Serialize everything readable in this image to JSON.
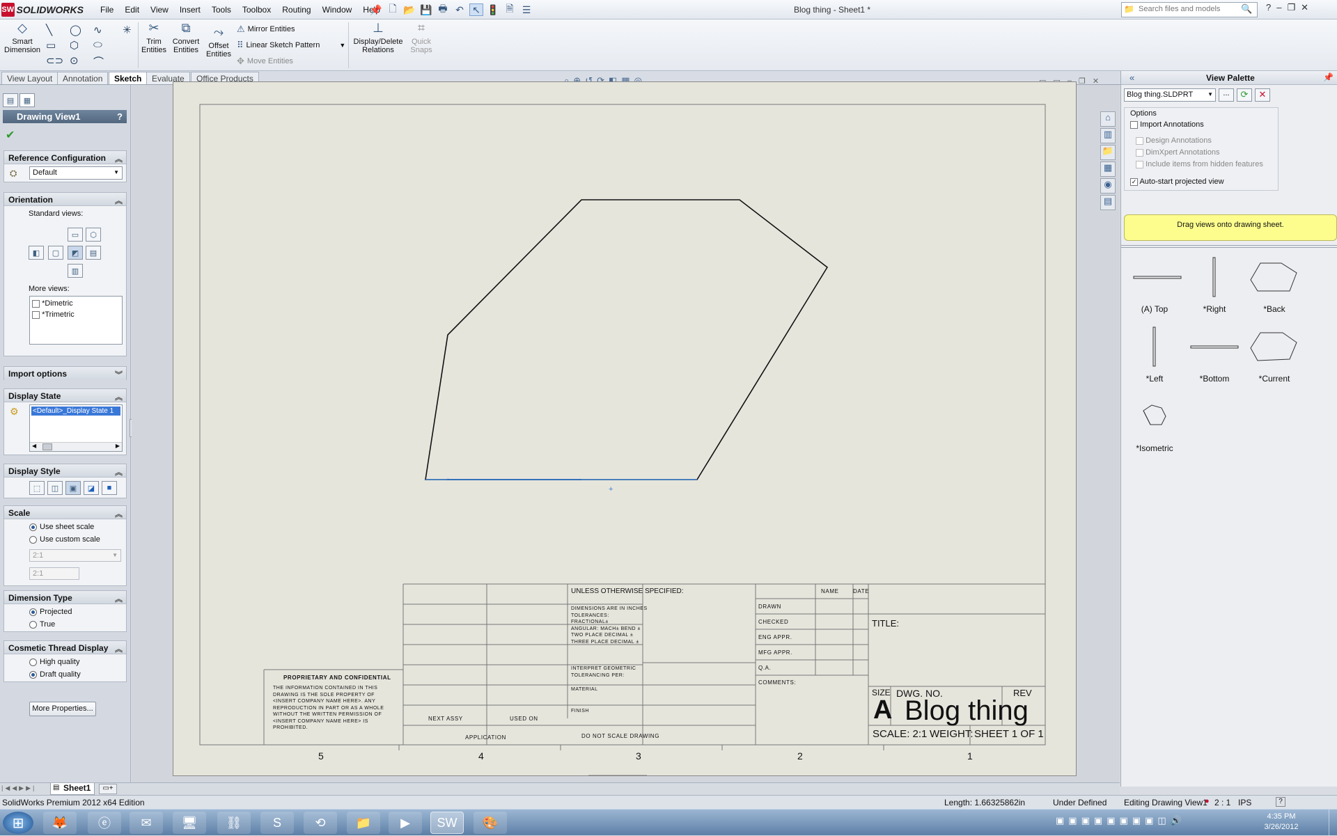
{
  "app": {
    "logo_text": "SOLIDWORKS",
    "document_title": "Blog thing - Sheet1 *",
    "menu": [
      "File",
      "Edit",
      "View",
      "Insert",
      "Tools",
      "Toolbox",
      "Routing",
      "Window",
      "Help"
    ],
    "search_placeholder": "Search files and models"
  },
  "ribbon": {
    "smart_dimension": "Smart Dimension",
    "trim_entities": "Trim Entities",
    "convert_entities": "Convert Entities",
    "offset_entities": "Offset Entities",
    "mirror_entities": "Mirror Entities",
    "linear_sketch_pattern": "Linear Sketch Pattern",
    "move_entities": "Move Entities",
    "display_delete_relations": "Display/Delete Relations",
    "quick_snaps": "Quick Snaps"
  },
  "tabs": [
    "View Layout",
    "Annotation",
    "Sketch",
    "Evaluate",
    "Office Products"
  ],
  "propertymanager": {
    "title": "Drawing View1",
    "help": "?",
    "ref_config": {
      "header": "Reference Configuration",
      "selected": "Default"
    },
    "orientation": {
      "header": "Orientation",
      "standard_views": "Standard views:",
      "more_views": "More views:",
      "more_list": [
        "*Dimetric",
        "*Trimetric"
      ]
    },
    "import_options": "Import options",
    "display_state": {
      "header": "Display State",
      "selected": "<Default>_Display State 1"
    },
    "display_style": "Display Style",
    "scale": {
      "header": "Scale",
      "use_sheet": "Use sheet scale",
      "use_custom": "Use custom scale",
      "select_value": "2:1",
      "custom_value": "2:1"
    },
    "dimension_type": {
      "header": "Dimension Type",
      "projected": "Projected",
      "true": "True"
    },
    "cosmetic_thread": {
      "header": "Cosmetic Thread Display",
      "high": "High quality",
      "draft": "Draft quality"
    },
    "more_properties": "More Properties..."
  },
  "palette": {
    "title": "View Palette",
    "file": "Blog thing.SLDPRT",
    "browse": "...",
    "options_label": "Options",
    "import_annotations": "Import Annotations",
    "design_annotations": "Design Annotations",
    "dimxpert_annotations": "DimXpert Annotations",
    "hidden_features": "Include items from hidden features",
    "auto_start": "Auto-start projected view",
    "hint": "Drag views onto drawing sheet.",
    "views": [
      "(A) Top",
      "*Right",
      "*Back",
      "*Left",
      "*Bottom",
      "*Current",
      "*Isometric"
    ]
  },
  "title_block": {
    "proprietary_header": "PROPRIETARY AND CONFIDENTIAL",
    "proprietary_text": [
      "THE INFORMATION CONTAINED IN THIS",
      "DRAWING IS THE SOLE PROPERTY OF",
      "<INSERT COMPANY NAME HERE>. ANY",
      "REPRODUCTION IN PART OR AS A WHOLE",
      "WITHOUT THE WRITTEN PERMISSION OF",
      "<INSERT COMPANY NAME HERE> IS",
      "PROHIBITED."
    ],
    "next_assy": "NEXT ASSY",
    "used_on": "USED ON",
    "application": "APPLICATION",
    "unless": "UNLESS OTHERWISE SPECIFIED:",
    "tolerance_lines": [
      "DIMENSIONS ARE IN INCHES",
      "TOLERANCES:",
      "FRACTIONAL±",
      "ANGULAR: MACH±    BEND ±",
      "TWO PLACE DECIMAL    ±",
      "THREE PLACE DECIMAL   ±"
    ],
    "interpret": [
      "INTERPRET GEOMETRIC",
      "TOLERANCING PER:"
    ],
    "material": "MATERIAL",
    "finish": "FINISH",
    "no_scale": "DO NOT SCALE DRAWING",
    "name_col": "NAME",
    "date_col": "DATE",
    "roles": [
      "DRAWN",
      "CHECKED",
      "ENG APPR.",
      "MFG APPR.",
      "Q.A."
    ],
    "comments": "COMMENTS:",
    "title_label": "TITLE:",
    "size_label": "SIZE",
    "size_value": "A",
    "dwg_no_label": "DWG. NO.",
    "dwg_no_value": "Blog thing",
    "rev_label": "REV",
    "scale": "SCALE: 2:1",
    "weight": "WEIGHT:",
    "sheet": "SHEET 1 OF 1",
    "zones": [
      "5",
      "4",
      "3",
      "2",
      "1"
    ]
  },
  "sheet_tab": "Sheet1",
  "status": {
    "edition": "SolidWorks Premium 2012 x64 Edition",
    "length": "Length: 1.66325862in",
    "defined": "Under Defined",
    "editing": "Editing Drawing View1",
    "scale": "2 : 1",
    "units": "IPS",
    "help": "?"
  },
  "clock": {
    "time": "4:35 PM",
    "date": "3/26/2012"
  }
}
